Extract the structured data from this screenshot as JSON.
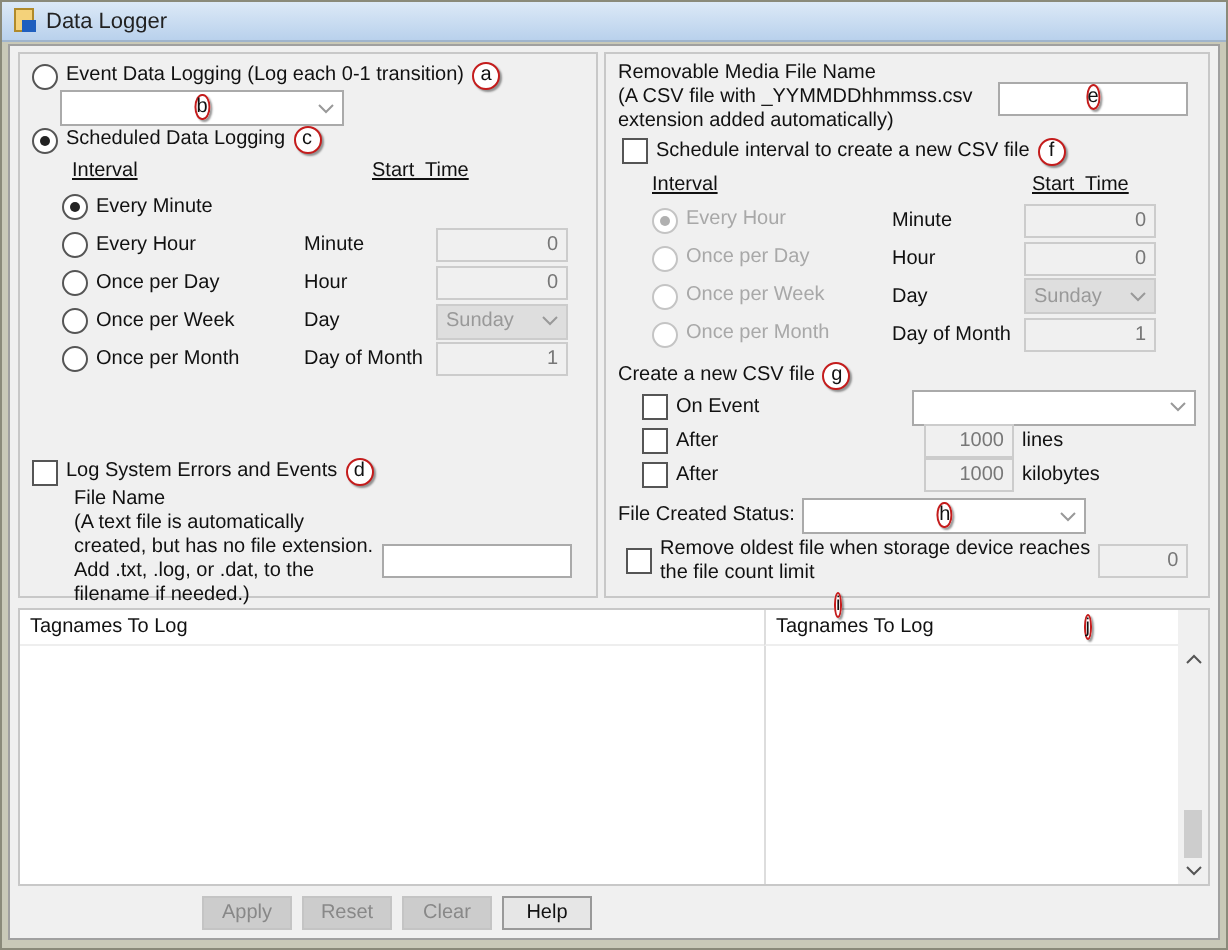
{
  "window": {
    "title": "Data Logger"
  },
  "event_logging": {
    "label": "Event Data Logging (Log each 0-1 transition)",
    "selected": false,
    "callout": "a",
    "dropdown_callout": "b"
  },
  "scheduled_logging": {
    "label": "Scheduled Data Logging",
    "selected": true,
    "callout": "c",
    "interval_header": "Interval",
    "start_header": "Start  Time",
    "intervals": [
      {
        "label": "Every Minute",
        "selected": true
      },
      {
        "label": "Every Hour",
        "selected": false
      },
      {
        "label": "Once per Day",
        "selected": false
      },
      {
        "label": "Once per Week",
        "selected": false
      },
      {
        "label": "Once per Month",
        "selected": false
      }
    ],
    "fields": [
      {
        "kind": "number",
        "label": "Minute",
        "value": "0"
      },
      {
        "kind": "number",
        "label": "Hour",
        "value": "0"
      },
      {
        "kind": "select",
        "label": "Day",
        "value": "Sunday"
      },
      {
        "kind": "number",
        "label": "Day of Month",
        "value": "1"
      }
    ]
  },
  "log_system": {
    "label": "Log System Errors and Events",
    "checked": false,
    "callout": "d",
    "file_name_label": "File Name",
    "note": "(A text file is automatically\ncreated, but has no file extension.\nAdd .txt, .log, or .dat, to the\nfilename if needed.)"
  },
  "media": {
    "label": "Removable Media File Name\n(A CSV file with _YYMMDDhhmmss.csv\nextension added automatically)",
    "field_callout": "e"
  },
  "schedule_csv": {
    "label": "Schedule interval to create a new CSV file",
    "checked": false,
    "callout": "f",
    "interval_header": "Interval",
    "start_header": "Start  Time",
    "intervals": [
      {
        "label": "Every Hour",
        "selected": true
      },
      {
        "label": "Once per Day",
        "selected": false
      },
      {
        "label": "Once per Week",
        "selected": false
      },
      {
        "label": "Once per Month",
        "selected": false
      }
    ],
    "fields": [
      {
        "kind": "number",
        "label": "Minute",
        "value": "0"
      },
      {
        "kind": "number",
        "label": "Hour",
        "value": "0"
      },
      {
        "kind": "select",
        "label": "Day",
        "value": "Sunday"
      },
      {
        "kind": "number",
        "label": "Day of Month",
        "value": "1"
      }
    ]
  },
  "create_csv": {
    "title": "Create a new CSV file",
    "callout": "g",
    "options": [
      {
        "kind": "select",
        "label": "On Event",
        "checked": false
      },
      {
        "kind": "number",
        "label": "After",
        "checked": false,
        "value": "1000",
        "unit": "lines"
      },
      {
        "kind": "number",
        "label": "After",
        "checked": false,
        "value": "1000",
        "unit": "kilobytes"
      }
    ]
  },
  "file_status": {
    "label": "File Created Status:",
    "callout": "h"
  },
  "remove_oldest": {
    "label": "Remove oldest file when storage device reaches\nthe file count limit",
    "checked": false,
    "value": "0",
    "callout": "i"
  },
  "table": {
    "columns": [
      {
        "header": "Tagnames To Log"
      },
      {
        "header": "Tagnames To Log",
        "callout": "j"
      }
    ]
  },
  "buttons": [
    {
      "label": "Apply",
      "disabled": true
    },
    {
      "label": "Reset",
      "disabled": true
    },
    {
      "label": "Clear",
      "disabled": true
    },
    {
      "label": "Help",
      "disabled": false
    }
  ]
}
